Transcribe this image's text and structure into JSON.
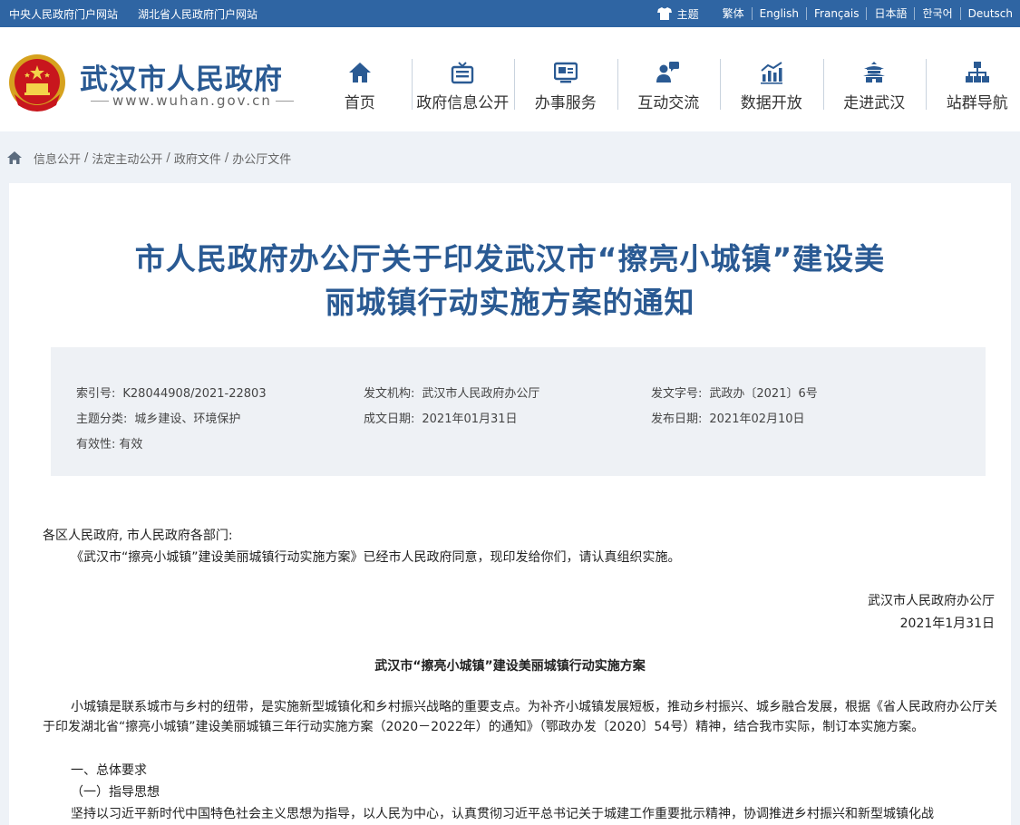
{
  "topbar": {
    "links": [
      "中央人民政府门户网站",
      "湖北省人民政府门户网站"
    ],
    "theme_label": "主题",
    "languages": [
      "繁体",
      "English",
      "Français",
      "日本語",
      "한국어",
      "Deutsch"
    ]
  },
  "header": {
    "site_name": "武汉市人民政府",
    "site_url": "www.wuhan.gov.cn",
    "nav": [
      {
        "label": "首页",
        "icon": "home-icon"
      },
      {
        "label": "政府信息公开",
        "icon": "info-disclosure-icon"
      },
      {
        "label": "办事服务",
        "icon": "service-icon"
      },
      {
        "label": "互动交流",
        "icon": "interaction-icon"
      },
      {
        "label": "数据开放",
        "icon": "data-chart-icon"
      },
      {
        "label": "走进武汉",
        "icon": "pavilion-icon"
      },
      {
        "label": "站群导航",
        "icon": "sitemap-icon"
      }
    ]
  },
  "breadcrumb": [
    "信息公开",
    "法定主动公开",
    "政府文件",
    "办公厅文件"
  ],
  "document": {
    "title_line1": "市人民政府办公厅关于印发武汉市“擦亮小城镇”建设美",
    "title_line2": "丽城镇行动实施方案的通知",
    "meta": {
      "index_label": "索引号:",
      "index_value": "K28044908/2021-22803",
      "issuer_label": "发文机构:",
      "issuer_value": "武汉市人民政府办公厅",
      "doc_no_label": "发文字号:",
      "doc_no_value": "武政办〔2021〕6号",
      "topic_label": "主题分类:",
      "topic_value": "城乡建设、环境保护",
      "written_label": "成文日期:",
      "written_value": "2021年01月31日",
      "published_label": "发布日期:",
      "published_value": "2021年02月10日",
      "validity_label": "有效性:",
      "validity_value": "有效"
    },
    "salutation": "各区人民政府, 市人民政府各部门:",
    "intro": "《武汉市“擦亮小城镇”建设美丽城镇行动实施方案》已经市人民政府同意，现印发给你们，请认真组织实施。",
    "signature_org": "武汉市人民政府办公厅",
    "signature_date": "2021年1月31日",
    "plan_title": "武汉市“擦亮小城镇”建设美丽城镇行动实施方案",
    "para1": "小城镇是联系城市与乡村的纽带，是实施新型城镇化和乡村振兴战略的重要支点。为补齐小城镇发展短板，推动乡村振兴、城乡融合发展，根据《省人民政府办公厅关于印发湖北省“擦亮小城镇”建设美丽城镇三年行动实施方案（2020－2022年）的通知》（鄂政办发〔2020〕54号）精神，结合我市实际，制订本实施方案。",
    "section1": "一、总体要求",
    "section1_1": "（一）指导思想",
    "para2": "坚持以习近平新时代中国特色社会主义思想为指导，以人民为中心，认真贯彻习近平总书记关于城建工作重要批示精神，协调推进乡村振兴和新型城镇化战"
  },
  "colors": {
    "topbar_bg": "#2f65a3",
    "title_blue": "#2a5a93",
    "page_bg": "#eef2f7",
    "meta_bg": "#eef1f5"
  }
}
